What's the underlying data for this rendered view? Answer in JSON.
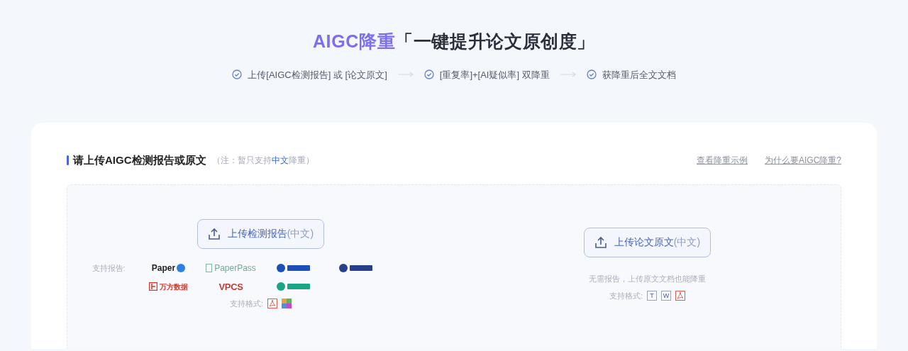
{
  "hero": {
    "title_highlight": "AIGC降重",
    "title_rest": "「一键提升论文原创度」",
    "steps": [
      {
        "label": "上传[AIGC检测报告] 或 [论文原文]"
      },
      {
        "label": "[重复率]+[AI疑似率] 双降重"
      },
      {
        "label": "获降重后全文文档"
      }
    ]
  },
  "panel": {
    "heading": "请上传AIGC检测报告或原文",
    "note": [
      {
        "text": "（注：暂只支持",
        "highlight": false
      },
      {
        "text": "中文",
        "highlight": true
      },
      {
        "text": "降重）",
        "highlight": false
      }
    ],
    "links": [
      "查看降重示例",
      "为什么要AIGC降重?"
    ],
    "upload_report": {
      "button": "上传检测报告",
      "button_suffix": "(中文)",
      "reports_label": "支持报告:",
      "reports": [
        {
          "kind": "paper",
          "text": "Paper"
        },
        {
          "kind": "paperpass",
          "text": "PaperPass"
        },
        {
          "kind": "mark",
          "color": "#1d4fb8"
        },
        {
          "kind": "mark",
          "color": "#27408b"
        },
        {
          "kind": "wanfang",
          "text": "万方数据"
        },
        {
          "kind": "vpcs",
          "text": "VPCS"
        },
        {
          "kind": "mark",
          "color": "#1aa586"
        }
      ],
      "formats_label": "支持格式:",
      "formats": [
        {
          "kind": "pdf"
        },
        {
          "kind": "zip"
        }
      ]
    },
    "upload_paper": {
      "button": "上传论文原文",
      "button_suffix": "(中文)",
      "hint": "无需报告，上传原文文档也能降重",
      "formats_label": "支持格式:",
      "formats": [
        {
          "kind": "txt",
          "text": "T"
        },
        {
          "kind": "doc",
          "text": "W"
        },
        {
          "kind": "pdf"
        }
      ]
    }
  }
}
